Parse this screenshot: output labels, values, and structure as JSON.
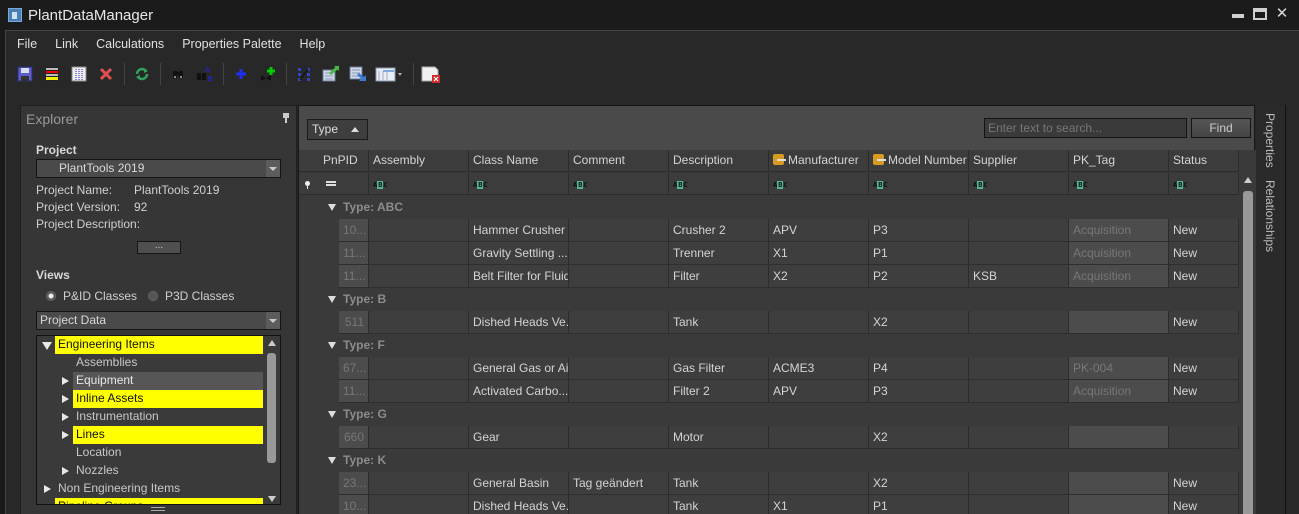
{
  "window": {
    "title": "PlantDataManager"
  },
  "menu": [
    "File",
    "Link",
    "Calculations",
    "Properties Palette",
    "Help"
  ],
  "toolbar": [
    {
      "icon": "save-icon"
    },
    {
      "icon": "row-colors-icon"
    },
    {
      "icon": "columns-icon"
    },
    {
      "icon": "delete-icon"
    },
    {
      "icon": "refresh-icon"
    },
    {
      "icon": "find-icon"
    },
    {
      "icon": "find-replace-icon"
    },
    {
      "icon": "add-icon"
    },
    {
      "icon": "add-valve-icon"
    },
    {
      "icon": "link-icon"
    },
    {
      "icon": "export-icon"
    },
    {
      "icon": "import-icon"
    },
    {
      "icon": "view-layout-icon"
    },
    {
      "icon": "close-report-icon"
    }
  ],
  "explorer": {
    "title": "Explorer",
    "project_label": "Project",
    "project_selected": "PlantTools 2019",
    "properties": [
      {
        "key": "Project Name:",
        "value": "PlantTools 2019"
      },
      {
        "key": "Project Version:",
        "value": "92"
      },
      {
        "key": "Project Description:",
        "value": ""
      }
    ],
    "more_button": "...",
    "views_label": "Views",
    "radios": [
      {
        "label": "P&ID Classes",
        "checked": true
      },
      {
        "label": "P3D Classes",
        "checked": false
      }
    ],
    "data_source": "Project Data",
    "tree": [
      {
        "label": "Engineering Items",
        "level": 0,
        "expander": "expanded",
        "highlight": true
      },
      {
        "label": "Assemblies",
        "level": 1,
        "expander": "none",
        "highlight": false
      },
      {
        "label": "Equipment",
        "level": 1,
        "expander": "collapsed",
        "highlight": false,
        "selected": true
      },
      {
        "label": "Inline Assets",
        "level": 1,
        "expander": "collapsed",
        "highlight": true
      },
      {
        "label": "Instrumentation",
        "level": 1,
        "expander": "collapsed",
        "highlight": false
      },
      {
        "label": "Lines",
        "level": 1,
        "expander": "collapsed",
        "highlight": true
      },
      {
        "label": "Location",
        "level": 1,
        "expander": "none",
        "highlight": false
      },
      {
        "label": "Nozzles",
        "level": 1,
        "expander": "collapsed",
        "highlight": false
      },
      {
        "label": "Non Engineering Items",
        "level": 0,
        "expander": "collapsed",
        "highlight": false
      },
      {
        "label": "Pipeline Groups",
        "level": 0,
        "expander": "none",
        "highlight": true
      }
    ]
  },
  "grid": {
    "group_by": "Type",
    "search_placeholder": "Enter text to search...",
    "find_label": "Find",
    "columns": [
      {
        "label": "PnPID",
        "icon": ""
      },
      {
        "label": "Assembly",
        "icon": ""
      },
      {
        "label": "Class Name",
        "icon": ""
      },
      {
        "label": "Comment",
        "icon": ""
      },
      {
        "label": "Description",
        "icon": ""
      },
      {
        "label": "Manufacturer",
        "icon": "linked-property-icon"
      },
      {
        "label": "Model Number",
        "icon": "linked-property-icon"
      },
      {
        "label": "Supplier",
        "icon": ""
      },
      {
        "label": "PK_Tag",
        "icon": ""
      },
      {
        "label": "Status",
        "icon": ""
      }
    ],
    "groups": [
      {
        "label": "Type: ABC",
        "rows": [
          [
            "10...",
            "",
            "Hammer Crusher",
            "",
            "Crusher 2",
            "APV",
            "P3",
            "",
            "Acquisition",
            "New"
          ],
          [
            "11...",
            "",
            "Gravity Settling ...",
            "",
            "Trenner",
            "X1",
            "P1",
            "",
            "Acquisition",
            "New"
          ],
          [
            "11...",
            "",
            "Belt Filter for Fluids",
            "",
            "Filter",
            "X2",
            "P2",
            "KSB",
            "Acquisition",
            "New"
          ]
        ]
      },
      {
        "label": "Type: B",
        "rows": [
          [
            "511",
            "",
            "Dished Heads Ve...",
            "",
            "Tank",
            "",
            "X2",
            "",
            "",
            "New"
          ]
        ]
      },
      {
        "label": "Type: F",
        "rows": [
          [
            "67...",
            "",
            "General Gas or Ai...",
            "",
            "Gas Filter",
            "ACME3",
            "P4",
            "",
            "PK-004",
            "New"
          ],
          [
            "11...",
            "",
            "Activated Carbo...",
            "",
            "Filter 2",
            "APV",
            "P3",
            "",
            "Acquisition",
            "New"
          ]
        ]
      },
      {
        "label": "Type: G",
        "rows": [
          [
            "660",
            "",
            "Gear",
            "",
            "Motor",
            "",
            "X2",
            "",
            "",
            ""
          ]
        ]
      },
      {
        "label": "Type: K",
        "rows": [
          [
            "23...",
            "",
            "General Basin",
            "Tag geändert",
            "Tank",
            "",
            "X2",
            "",
            "",
            "New"
          ],
          [
            "10...",
            "",
            "Dished Heads Ve...",
            "",
            "Tank",
            "X1",
            "P1",
            "",
            "",
            "New"
          ]
        ]
      }
    ]
  },
  "side_tabs": [
    "Properties",
    "Relationships"
  ],
  "colors": {
    "highlight": "#ffff00",
    "background": "#282828",
    "abc_filter": "#4fb98f",
    "linked_header": "#d69b1f"
  }
}
